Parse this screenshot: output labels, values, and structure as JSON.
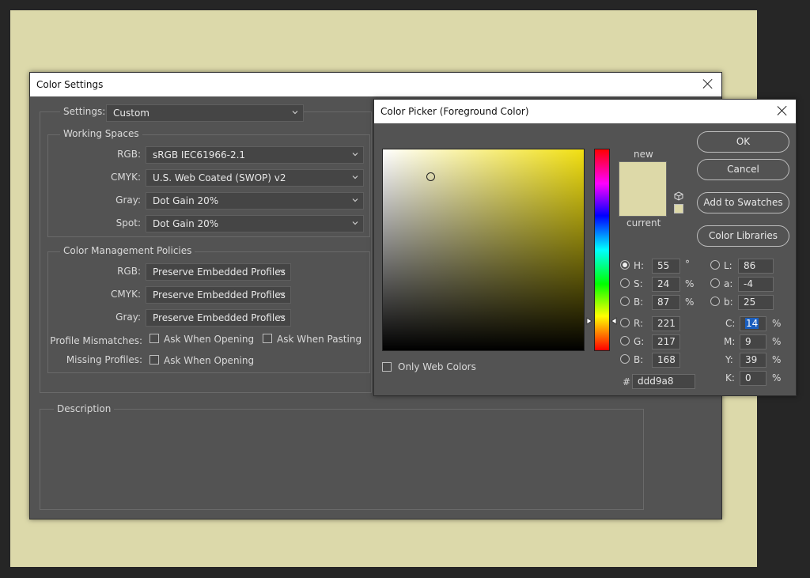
{
  "colors": {
    "canvas_bg": "#dcd9aa",
    "dialog_bg": "#535353",
    "swatch": "#ddd9a8"
  },
  "color_settings": {
    "title": "Color Settings",
    "settings_label": "Settings:",
    "settings_value": "Custom",
    "working_spaces": {
      "legend": "Working Spaces",
      "rgb_label": "RGB:",
      "rgb_value": "sRGB IEC61966-2.1",
      "cmyk_label": "CMYK:",
      "cmyk_value": "U.S. Web Coated (SWOP) v2",
      "gray_label": "Gray:",
      "gray_value": "Dot Gain 20%",
      "spot_label": "Spot:",
      "spot_value": "Dot Gain 20%"
    },
    "policies": {
      "legend": "Color Management Policies",
      "rgb_label": "RGB:",
      "rgb_value": "Preserve Embedded Profiles",
      "cmyk_label": "CMYK:",
      "cmyk_value": "Preserve Embedded Profiles",
      "gray_label": "Gray:",
      "gray_value": "Preserve Embedded Profiles",
      "mismatch_label": "Profile Mismatches:",
      "mismatch_opening": "Ask When Opening",
      "mismatch_pasting": "Ask When Pasting",
      "missing_label": "Missing Profiles:",
      "missing_opening": "Ask When Opening"
    },
    "description_legend": "Description"
  },
  "color_picker": {
    "title": "Color Picker (Foreground Color)",
    "new_label": "new",
    "current_label": "current",
    "only_web_colors": "Only Web Colors",
    "buttons": {
      "ok": "OK",
      "cancel": "Cancel",
      "add_swatches": "Add to Swatches",
      "color_libraries": "Color Libraries"
    },
    "hsb": {
      "h_label": "H:",
      "h_value": "55",
      "h_unit": "°",
      "s_label": "S:",
      "s_value": "24",
      "s_unit": "%",
      "b_label": "B:",
      "b_value": "87",
      "b_unit": "%"
    },
    "rgb": {
      "r_label": "R:",
      "r_value": "221",
      "g_label": "G:",
      "g_value": "217",
      "b_label": "B:",
      "b_value": "168"
    },
    "lab": {
      "l_label": "L:",
      "l_value": "86",
      "a_label": "a:",
      "a_value": "-4",
      "b_label": "b:",
      "b_value": "25"
    },
    "cmyk": {
      "c_label": "C:",
      "c_value": "14",
      "c_unit": "%",
      "m_label": "M:",
      "m_value": "9",
      "m_unit": "%",
      "y_label": "Y:",
      "y_value": "39",
      "y_unit": "%",
      "k_label": "K:",
      "k_value": "0",
      "k_unit": "%"
    },
    "hex_label": "#",
    "hex_value": "ddd9a8"
  }
}
